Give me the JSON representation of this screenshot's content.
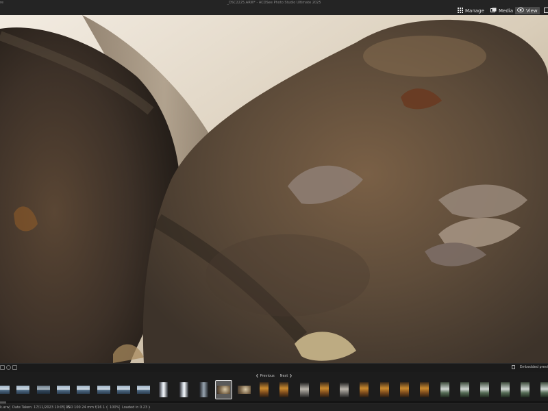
{
  "window": {
    "menu_fragment": "re",
    "title": "_DSC2225.ARW* - ACDSee Photo Studio Ultimate 2025"
  },
  "modes": [
    {
      "label": "Manage",
      "icon": "grid-icon",
      "active": false
    },
    {
      "label": "Media",
      "icon": "media-icon",
      "active": false
    },
    {
      "label": "View",
      "icon": "eye-icon",
      "active": true
    }
  ],
  "viewer_toolbar": {
    "embedded_preview_label": "Embedded previ"
  },
  "filmstrip": {
    "previous_label": "Previous",
    "next_label": "Next",
    "selected_index": 11,
    "thumbnails": [
      {
        "kind": "lake",
        "orientation": "landscape"
      },
      {
        "kind": "lake",
        "orientation": "landscape"
      },
      {
        "kind": "lake-dark",
        "orientation": "landscape"
      },
      {
        "kind": "lake",
        "orientation": "landscape"
      },
      {
        "kind": "lake",
        "orientation": "landscape"
      },
      {
        "kind": "lake",
        "orientation": "landscape"
      },
      {
        "kind": "lake",
        "orientation": "landscape"
      },
      {
        "kind": "lake",
        "orientation": "landscape"
      },
      {
        "kind": "waterfall",
        "orientation": "portrait"
      },
      {
        "kind": "waterfall",
        "orientation": "portrait"
      },
      {
        "kind": "waterfall-dark",
        "orientation": "portrait"
      },
      {
        "kind": "rock",
        "orientation": "landscape"
      },
      {
        "kind": "rock",
        "orientation": "landscape"
      },
      {
        "kind": "autumn",
        "orientation": "portrait"
      },
      {
        "kind": "autumn",
        "orientation": "portrait"
      },
      {
        "kind": "dark",
        "orientation": "portrait"
      },
      {
        "kind": "autumn",
        "orientation": "portrait"
      },
      {
        "kind": "dark",
        "orientation": "portrait"
      },
      {
        "kind": "autumn",
        "orientation": "portrait"
      },
      {
        "kind": "autumn",
        "orientation": "portrait"
      },
      {
        "kind": "autumn",
        "orientation": "portrait"
      },
      {
        "kind": "autumn",
        "orientation": "portrait"
      },
      {
        "kind": "stream",
        "orientation": "portrait"
      },
      {
        "kind": "stream",
        "orientation": "portrait"
      },
      {
        "kind": "stream",
        "orientation": "portrait"
      },
      {
        "kind": "stream",
        "orientation": "portrait"
      },
      {
        "kind": "stream",
        "orientation": "portrait"
      },
      {
        "kind": "stream",
        "orientation": "portrait"
      }
    ]
  },
  "status": {
    "fragment": "k.arw",
    "date_taken": "Date Taken: 17/11/2023 10:05:15",
    "exposure": "ISO 100   24 mm   f/16   1 s",
    "zoom": "100%",
    "loaded": "Loaded in 0.23 s"
  },
  "colors": {
    "accent_active": "#4b4b4b",
    "chrome": "#242424"
  }
}
